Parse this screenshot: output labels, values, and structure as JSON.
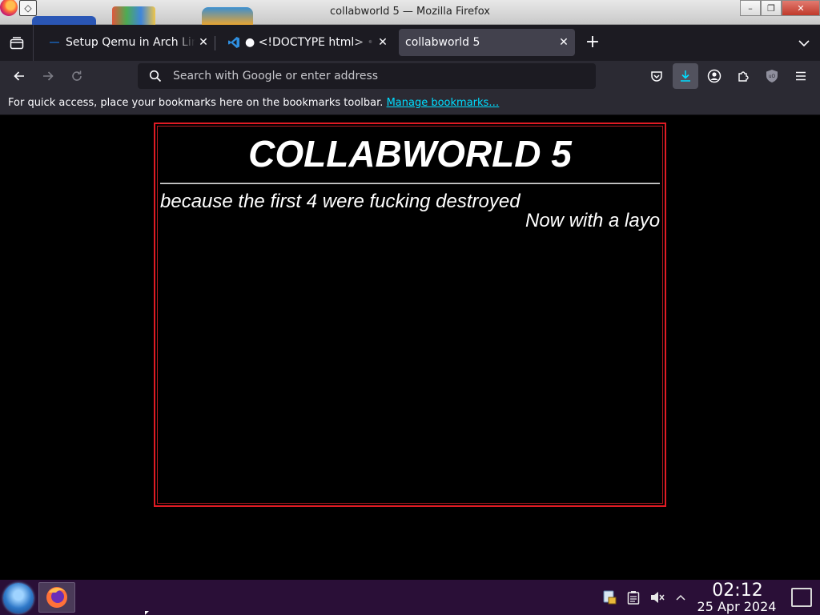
{
  "window": {
    "title": "collabworld 5 — Mozilla Firefox",
    "controls": {
      "minimize": "–",
      "maximize": "❐",
      "close": "✕"
    }
  },
  "tabs": [
    {
      "label": "Setup Qemu in Arch Linux",
      "icon": "page-icon",
      "active": false
    },
    {
      "label": "● <!DOCTYPE html> • a",
      "icon": "vscode-icon",
      "active": false
    },
    {
      "label": "collabworld 5",
      "icon": "",
      "active": true
    }
  ],
  "toolbar": {
    "new_tab": "+",
    "url_placeholder": "Search with Google or enter address",
    "icons": [
      "back-icon",
      "forward-icon",
      "reload-icon",
      "pocket-icon",
      "download-icon",
      "account-icon",
      "extensions-icon",
      "ublock-icon",
      "menu-icon"
    ]
  },
  "bookmarks_bar": {
    "message": "For quick access, place your bookmarks here on the bookmarks toolbar.",
    "link": "Manage bookmarks…"
  },
  "page": {
    "heading": "COLLABWORLD 5",
    "tagline": "because the first 4 were fucking destroyed",
    "marquee": "Now with a layo"
  },
  "taskbar": {
    "time": "02:12",
    "date": "25 Apr 2024",
    "tray_icons": [
      "network-icon",
      "clipboard-icon",
      "volume-muted-icon",
      "tray-expand-icon"
    ]
  },
  "colors": {
    "frame_border": "#e01b24",
    "link": "#00ddff",
    "taskbar": "#2a0f37",
    "active_tab": "#42414d"
  }
}
